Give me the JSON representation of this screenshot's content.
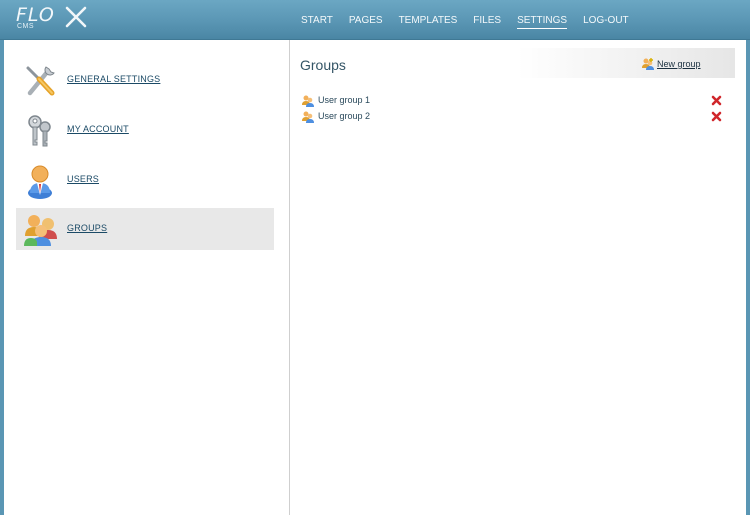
{
  "app": {
    "logo_text": "FLO",
    "logo_sub": "CMS"
  },
  "nav": [
    {
      "label": "START",
      "active": false
    },
    {
      "label": "PAGES",
      "active": false
    },
    {
      "label": "TEMPLATES",
      "active": false
    },
    {
      "label": "FILES",
      "active": false
    },
    {
      "label": "SETTINGS",
      "active": true
    },
    {
      "label": "LOG-OUT",
      "active": false
    }
  ],
  "sidebar": {
    "items": [
      {
        "label": "GENERAL SETTINGS",
        "icon": "tools-icon",
        "active": false
      },
      {
        "label": "MY ACCOUNT",
        "icon": "keys-icon",
        "active": false
      },
      {
        "label": "USERS",
        "icon": "user-icon",
        "active": false
      },
      {
        "label": "GROUPS",
        "icon": "group-icon",
        "active": true
      }
    ]
  },
  "main": {
    "title": "Groups",
    "new_group_label": "New group",
    "groups": [
      {
        "name": "User group 1"
      },
      {
        "name": "User group 2"
      }
    ]
  },
  "colors": {
    "header": "#5a96b4",
    "link": "#1b4a66",
    "active_item": "#e8e8e8",
    "delete": "#d0262b"
  }
}
